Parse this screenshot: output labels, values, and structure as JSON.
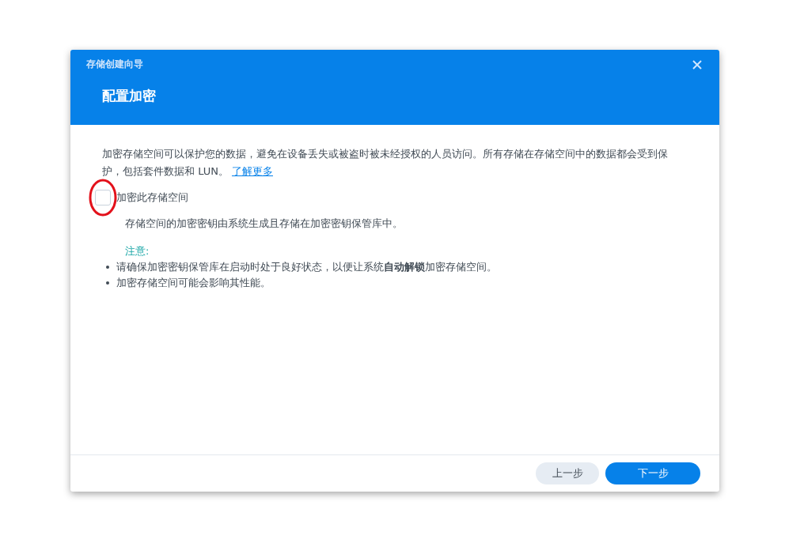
{
  "dialog": {
    "wizard_title": "存储创建向导",
    "step_title": "配置加密"
  },
  "intro": {
    "text": "加密存储空间可以保护您的数据，避免在设备丢失或被盗时被未经授权的人员访问。所有存储在存储空间中的数据都会受到保护，包括套件数据和 LUN。",
    "link": "了解更多"
  },
  "encrypt_option": {
    "label": "加密此存储空间",
    "checked": false,
    "highlighted": true,
    "description": "存储空间的加密密钥由系统生成且存储在加密密钥保管库中。"
  },
  "note": {
    "heading": "注意:",
    "items": [
      "请确保加密密钥保管库在启动时处于良好状态，以便让系统**自动解锁**加密存储空间。",
      "加密存储空间可能会影响其性能。"
    ]
  },
  "buttons": [
    {
      "label": "上一步",
      "kind": "secondary"
    },
    {
      "label": "下一步",
      "kind": "primary"
    }
  ]
}
